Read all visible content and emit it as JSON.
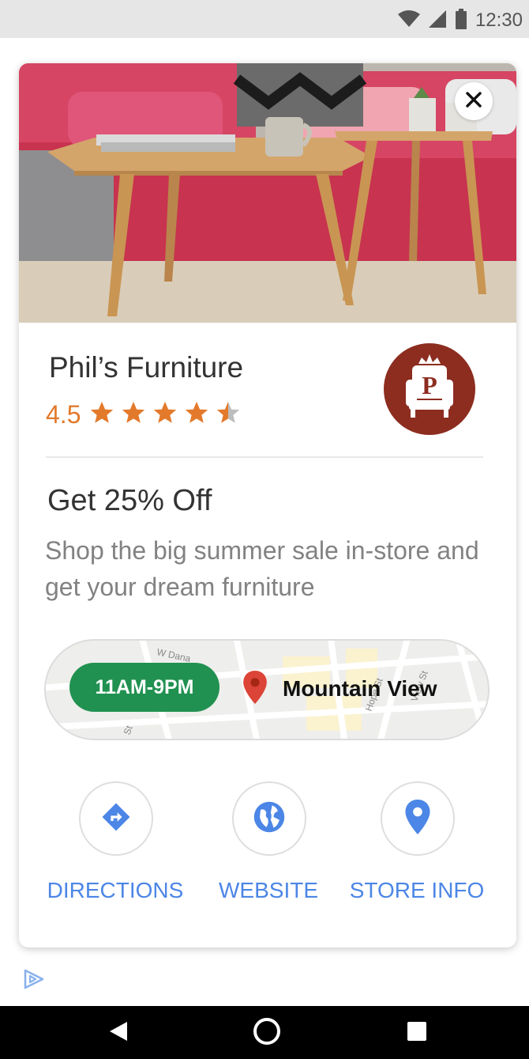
{
  "status_bar": {
    "time": "12:30",
    "icons": [
      "wifi-icon",
      "cell-signal-icon",
      "battery-icon"
    ]
  },
  "card": {
    "hero_image": "photo of wooden side tables in front of a red sofa",
    "close_icon": "close-icon",
    "business": {
      "name": "Phil’s Furniture",
      "rating": "4.5",
      "stars": 4.5,
      "logo_letter": "P"
    },
    "promo": {
      "headline": "Get 25% Off",
      "description": "Shop the big summer sale in-store and get your dream furniture"
    },
    "map": {
      "hours": "11AM-9PM",
      "location": "Mountain View",
      "street_labels": [
        "W Dana",
        "Hope St",
        "View St",
        "St"
      ]
    },
    "actions": [
      {
        "label": "DIRECTIONS",
        "icon": "directions-icon"
      },
      {
        "label": "WEBSITE",
        "icon": "globe-icon"
      },
      {
        "label": "STORE INFO",
        "icon": "location-pin-icon"
      }
    ]
  },
  "ad_choices_icon": "ad-choices-icon",
  "nav_bar": {
    "buttons": [
      "back-icon",
      "home-icon",
      "recents-icon"
    ]
  },
  "colors": {
    "accent_blue": "#4c86e6",
    "rating_orange": "#e37a2b",
    "hours_green": "#209150",
    "logo_red": "#8c2d20",
    "pin_red": "#db4437"
  }
}
